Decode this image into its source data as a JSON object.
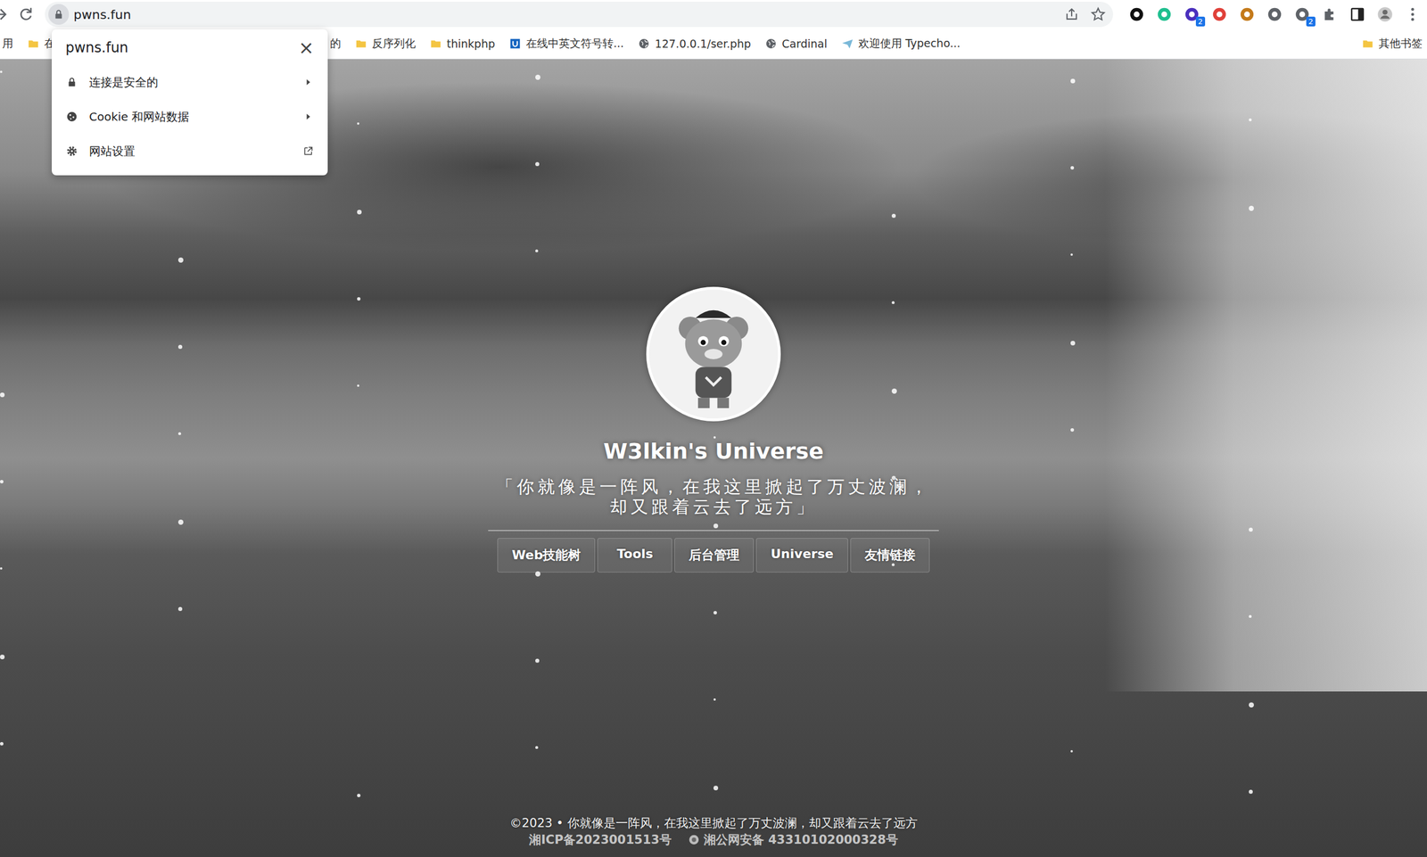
{
  "browser": {
    "address": "pwns.fun",
    "extensions": [
      {
        "badge": "",
        "color": "#111111"
      },
      {
        "badge": "",
        "color": "#1fbf8f"
      },
      {
        "badge": "2",
        "color": "#4a2fbd"
      },
      {
        "badge": "",
        "color": "#e0413a"
      },
      {
        "badge": "",
        "color": "#c47a1a"
      },
      {
        "badge": "",
        "color": "#5f6368"
      },
      {
        "badge": "2",
        "color": "#5f6368"
      }
    ]
  },
  "bookmarks": {
    "left": [
      {
        "label": "用",
        "kind": "plain"
      },
      {
        "label": "在",
        "kind": "folder"
      }
    ],
    "right": [
      {
        "label": "的",
        "kind": "plain"
      },
      {
        "label": "反序列化",
        "kind": "folder"
      },
      {
        "label": "thinkphp",
        "kind": "folder"
      },
      {
        "label": "在线中英文符号转...",
        "kind": "badge"
      },
      {
        "label": "127.0.0.1/ser.php",
        "kind": "globe"
      },
      {
        "label": "Cardinal",
        "kind": "globe"
      },
      {
        "label": "欢迎使用 Typecho...",
        "kind": "plane"
      }
    ],
    "other": "其他书签"
  },
  "popup": {
    "title": "pwns.fun",
    "close": "×",
    "items": [
      {
        "label": "连接是安全的",
        "kind": "submenu",
        "icon": "lock"
      },
      {
        "label": "Cookie 和网站数据",
        "kind": "submenu",
        "icon": "cookie"
      },
      {
        "label": "网站设置",
        "kind": "external",
        "icon": "gear"
      }
    ]
  },
  "page": {
    "title": "W3lkin's Universe",
    "quote": [
      "「你就像是一阵风，在我这里掀起了万丈波澜，",
      "却又跟着云去了远方」"
    ],
    "nav": [
      "Web技能树",
      "Tools",
      "后台管理",
      "Universe",
      "友情链接"
    ],
    "footer": {
      "copyright": "©2023 • 你就像是一阵风，在我这里掀起了万丈波澜，却又跟着云去了远方",
      "icp": "湘ICP备2023001513号",
      "police": "湘公网安备 43310102000328号"
    }
  }
}
